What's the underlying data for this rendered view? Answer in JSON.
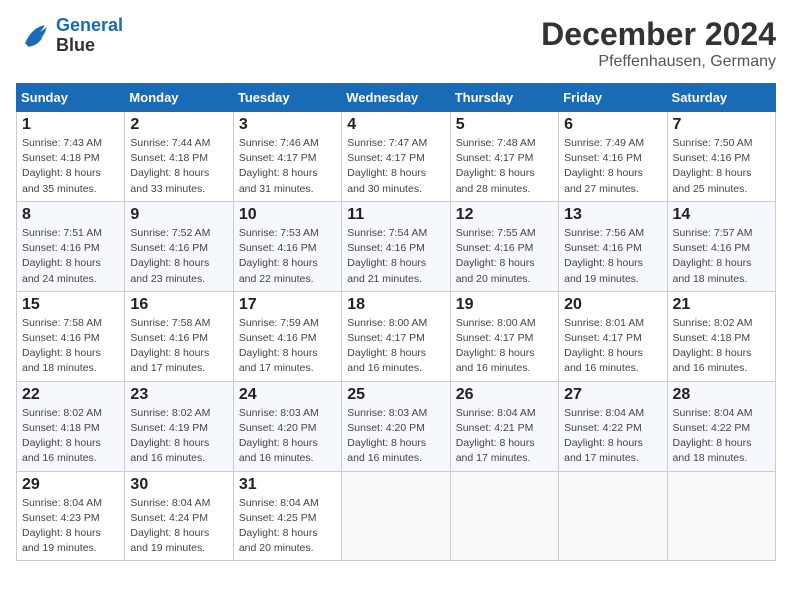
{
  "header": {
    "logo_line1": "General",
    "logo_line2": "Blue",
    "month": "December 2024",
    "location": "Pfeffenhausen, Germany"
  },
  "weekdays": [
    "Sunday",
    "Monday",
    "Tuesday",
    "Wednesday",
    "Thursday",
    "Friday",
    "Saturday"
  ],
  "weeks": [
    [
      {
        "day": "1",
        "sunrise": "Sunrise: 7:43 AM",
        "sunset": "Sunset: 4:18 PM",
        "daylight": "Daylight: 8 hours and 35 minutes."
      },
      {
        "day": "2",
        "sunrise": "Sunrise: 7:44 AM",
        "sunset": "Sunset: 4:18 PM",
        "daylight": "Daylight: 8 hours and 33 minutes."
      },
      {
        "day": "3",
        "sunrise": "Sunrise: 7:46 AM",
        "sunset": "Sunset: 4:17 PM",
        "daylight": "Daylight: 8 hours and 31 minutes."
      },
      {
        "day": "4",
        "sunrise": "Sunrise: 7:47 AM",
        "sunset": "Sunset: 4:17 PM",
        "daylight": "Daylight: 8 hours and 30 minutes."
      },
      {
        "day": "5",
        "sunrise": "Sunrise: 7:48 AM",
        "sunset": "Sunset: 4:17 PM",
        "daylight": "Daylight: 8 hours and 28 minutes."
      },
      {
        "day": "6",
        "sunrise": "Sunrise: 7:49 AM",
        "sunset": "Sunset: 4:16 PM",
        "daylight": "Daylight: 8 hours and 27 minutes."
      },
      {
        "day": "7",
        "sunrise": "Sunrise: 7:50 AM",
        "sunset": "Sunset: 4:16 PM",
        "daylight": "Daylight: 8 hours and 25 minutes."
      }
    ],
    [
      {
        "day": "8",
        "sunrise": "Sunrise: 7:51 AM",
        "sunset": "Sunset: 4:16 PM",
        "daylight": "Daylight: 8 hours and 24 minutes."
      },
      {
        "day": "9",
        "sunrise": "Sunrise: 7:52 AM",
        "sunset": "Sunset: 4:16 PM",
        "daylight": "Daylight: 8 hours and 23 minutes."
      },
      {
        "day": "10",
        "sunrise": "Sunrise: 7:53 AM",
        "sunset": "Sunset: 4:16 PM",
        "daylight": "Daylight: 8 hours and 22 minutes."
      },
      {
        "day": "11",
        "sunrise": "Sunrise: 7:54 AM",
        "sunset": "Sunset: 4:16 PM",
        "daylight": "Daylight: 8 hours and 21 minutes."
      },
      {
        "day": "12",
        "sunrise": "Sunrise: 7:55 AM",
        "sunset": "Sunset: 4:16 PM",
        "daylight": "Daylight: 8 hours and 20 minutes."
      },
      {
        "day": "13",
        "sunrise": "Sunrise: 7:56 AM",
        "sunset": "Sunset: 4:16 PM",
        "daylight": "Daylight: 8 hours and 19 minutes."
      },
      {
        "day": "14",
        "sunrise": "Sunrise: 7:57 AM",
        "sunset": "Sunset: 4:16 PM",
        "daylight": "Daylight: 8 hours and 18 minutes."
      }
    ],
    [
      {
        "day": "15",
        "sunrise": "Sunrise: 7:58 AM",
        "sunset": "Sunset: 4:16 PM",
        "daylight": "Daylight: 8 hours and 18 minutes."
      },
      {
        "day": "16",
        "sunrise": "Sunrise: 7:58 AM",
        "sunset": "Sunset: 4:16 PM",
        "daylight": "Daylight: 8 hours and 17 minutes."
      },
      {
        "day": "17",
        "sunrise": "Sunrise: 7:59 AM",
        "sunset": "Sunset: 4:16 PM",
        "daylight": "Daylight: 8 hours and 17 minutes."
      },
      {
        "day": "18",
        "sunrise": "Sunrise: 8:00 AM",
        "sunset": "Sunset: 4:17 PM",
        "daylight": "Daylight: 8 hours and 16 minutes."
      },
      {
        "day": "19",
        "sunrise": "Sunrise: 8:00 AM",
        "sunset": "Sunset: 4:17 PM",
        "daylight": "Daylight: 8 hours and 16 minutes."
      },
      {
        "day": "20",
        "sunrise": "Sunrise: 8:01 AM",
        "sunset": "Sunset: 4:17 PM",
        "daylight": "Daylight: 8 hours and 16 minutes."
      },
      {
        "day": "21",
        "sunrise": "Sunrise: 8:02 AM",
        "sunset": "Sunset: 4:18 PM",
        "daylight": "Daylight: 8 hours and 16 minutes."
      }
    ],
    [
      {
        "day": "22",
        "sunrise": "Sunrise: 8:02 AM",
        "sunset": "Sunset: 4:18 PM",
        "daylight": "Daylight: 8 hours and 16 minutes."
      },
      {
        "day": "23",
        "sunrise": "Sunrise: 8:02 AM",
        "sunset": "Sunset: 4:19 PM",
        "daylight": "Daylight: 8 hours and 16 minutes."
      },
      {
        "day": "24",
        "sunrise": "Sunrise: 8:03 AM",
        "sunset": "Sunset: 4:20 PM",
        "daylight": "Daylight: 8 hours and 16 minutes."
      },
      {
        "day": "25",
        "sunrise": "Sunrise: 8:03 AM",
        "sunset": "Sunset: 4:20 PM",
        "daylight": "Daylight: 8 hours and 16 minutes."
      },
      {
        "day": "26",
        "sunrise": "Sunrise: 8:04 AM",
        "sunset": "Sunset: 4:21 PM",
        "daylight": "Daylight: 8 hours and 17 minutes."
      },
      {
        "day": "27",
        "sunrise": "Sunrise: 8:04 AM",
        "sunset": "Sunset: 4:22 PM",
        "daylight": "Daylight: 8 hours and 17 minutes."
      },
      {
        "day": "28",
        "sunrise": "Sunrise: 8:04 AM",
        "sunset": "Sunset: 4:22 PM",
        "daylight": "Daylight: 8 hours and 18 minutes."
      }
    ],
    [
      {
        "day": "29",
        "sunrise": "Sunrise: 8:04 AM",
        "sunset": "Sunset: 4:23 PM",
        "daylight": "Daylight: 8 hours and 19 minutes."
      },
      {
        "day": "30",
        "sunrise": "Sunrise: 8:04 AM",
        "sunset": "Sunset: 4:24 PM",
        "daylight": "Daylight: 8 hours and 19 minutes."
      },
      {
        "day": "31",
        "sunrise": "Sunrise: 8:04 AM",
        "sunset": "Sunset: 4:25 PM",
        "daylight": "Daylight: 8 hours and 20 minutes."
      },
      null,
      null,
      null,
      null
    ]
  ]
}
